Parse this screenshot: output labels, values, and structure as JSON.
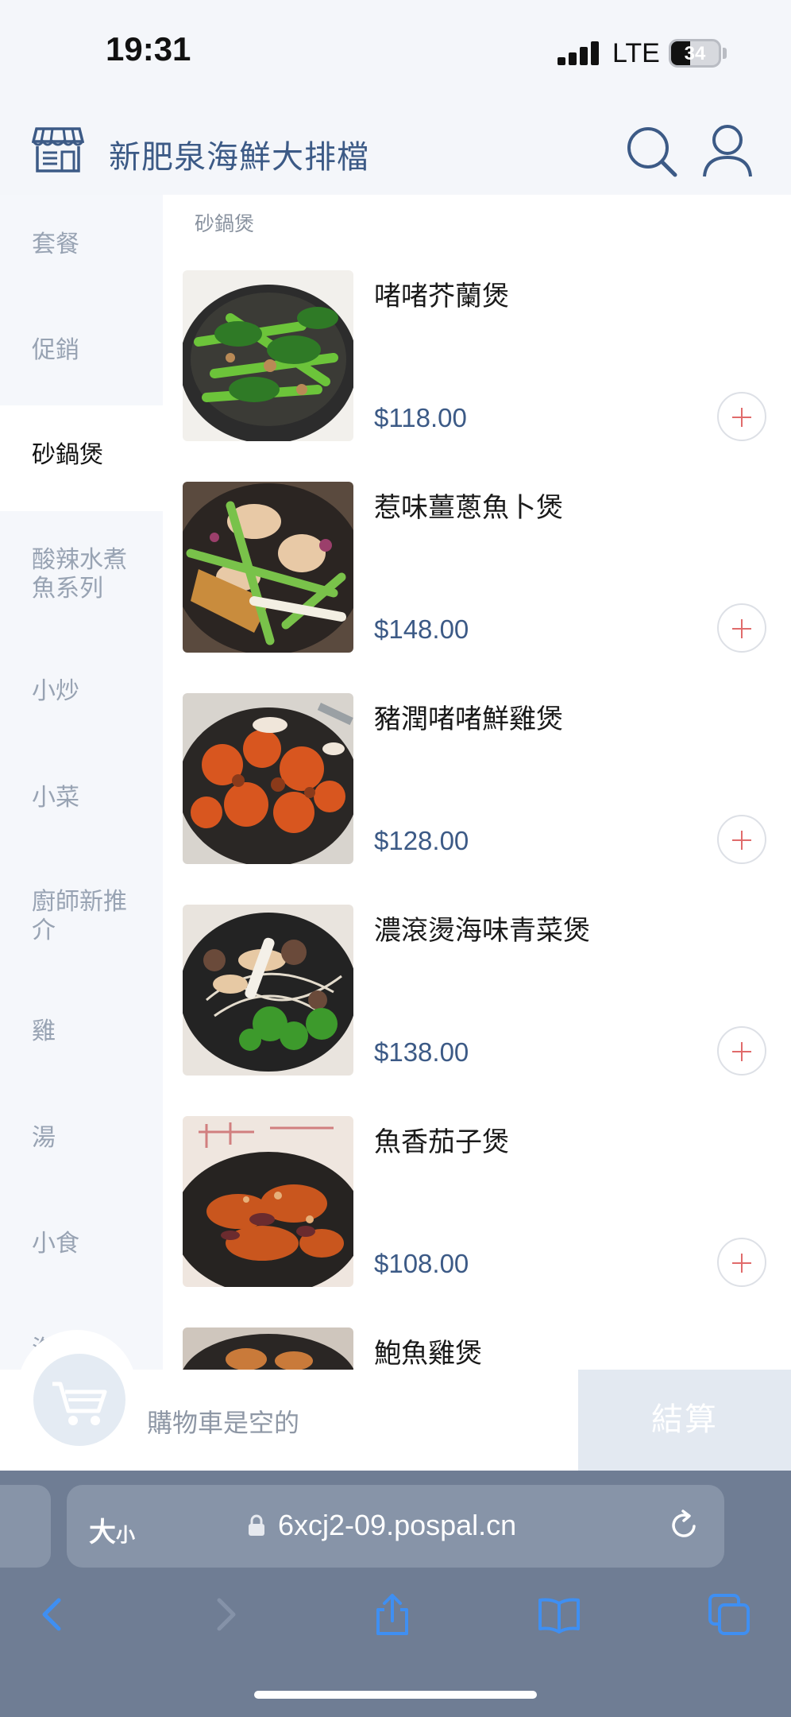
{
  "status": {
    "time": "19:31",
    "network": "LTE",
    "battery": "34"
  },
  "header": {
    "title": "新肥泉海鮮大排檔"
  },
  "sidebar": {
    "items": [
      {
        "label": "套餐"
      },
      {
        "label": "促銷"
      },
      {
        "label": "砂鍋煲"
      },
      {
        "label": "酸辣水煮魚系列"
      },
      {
        "label": "小炒"
      },
      {
        "label": "小菜"
      },
      {
        "label": "廚師新推介"
      },
      {
        "label": "雞"
      },
      {
        "label": "湯"
      },
      {
        "label": "小食"
      },
      {
        "label": "海"
      }
    ],
    "active_label": "砂鍋煲"
  },
  "section": {
    "title": "砂鍋煲"
  },
  "dishes": [
    {
      "name": "啫啫芥蘭煲",
      "price": "$118.00"
    },
    {
      "name": "惹味薑蔥魚卜煲",
      "price": "$148.00"
    },
    {
      "name": "豬潤啫啫鮮雞煲",
      "price": "$128.00"
    },
    {
      "name": "濃滾燙海味青菜煲",
      "price": "$138.00"
    },
    {
      "name": "魚香茄子煲",
      "price": "$108.00"
    },
    {
      "name": "鮑魚雞煲",
      "price": ""
    }
  ],
  "cart": {
    "empty_text": "購物車是空的",
    "checkout_label": "結算"
  },
  "browser": {
    "text_size_label": "大",
    "text_size_small": "小",
    "url": "6xcj2-09.pospal.cn"
  },
  "colors": {
    "brand": "#3c5a86",
    "accent_add": "#e06b6b",
    "browser_bar": "#6f7d94",
    "safari_blue": "#3f8ff2"
  }
}
